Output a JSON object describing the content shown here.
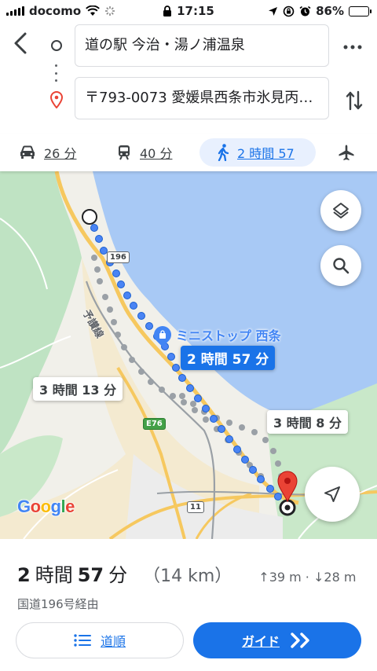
{
  "status_bar": {
    "carrier": "docomo",
    "time": "17:15",
    "battery": "86%",
    "icons": [
      "signal-icon",
      "wifi-icon",
      "loading-icon",
      "lock-icon",
      "location-arrow-icon",
      "screen-rotation-lock-icon",
      "alarm-icon",
      "battery-charging-icon"
    ]
  },
  "route": {
    "origin": "道の駅 今治・湯ノ浦温泉",
    "destination": "〒793-0073 愛媛県西条市氷見丙…"
  },
  "modes": [
    {
      "name": "car",
      "icon": "car-icon",
      "label": "26 分"
    },
    {
      "name": "train",
      "icon": "train-icon",
      "label": "40 分"
    },
    {
      "name": "walk",
      "icon": "walking-icon",
      "label": "2 時間 57",
      "selected": true
    },
    {
      "name": "flight",
      "icon": "airplane-icon",
      "label": ""
    }
  ],
  "map": {
    "route_labels": {
      "main": "2 時間 57 分",
      "alt1": "3 時間 13 分",
      "alt2": "3 時間 8 分"
    },
    "poi": "ミニストップ 西条",
    "rail_line": "予讃線",
    "road_shields": [
      "196",
      "E76",
      "11"
    ],
    "logo": "Google"
  },
  "summary": {
    "duration_hours": "2",
    "duration_hours_unit": "時間",
    "duration_minutes": "57",
    "duration_minutes_unit": "分",
    "distance": "（14 km）",
    "elevation": "↑39 m · ↓28 m",
    "via": "国道196号経由"
  },
  "buttons": {
    "steps": "道順",
    "guide": "ガイド"
  },
  "colors": {
    "accent": "#1a73e8",
    "water": "#a8c9f5",
    "land_green": "#bfe3c3",
    "urban": "#f1f0ea",
    "road_yellow": "#f6c85f",
    "pin_red": "#ea4335"
  }
}
